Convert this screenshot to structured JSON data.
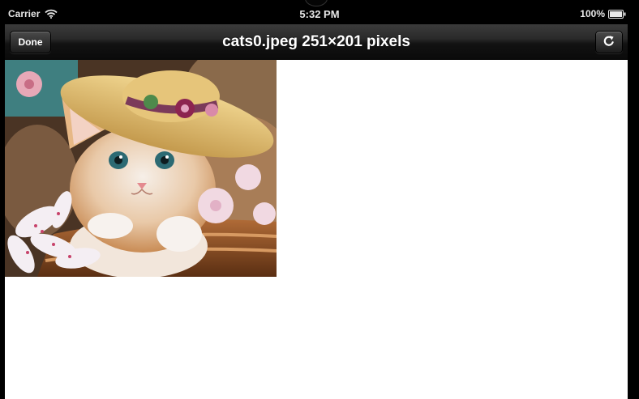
{
  "status_bar": {
    "carrier": "Carrier",
    "time": "5:32 PM",
    "battery": "100%",
    "icons": [
      "wifi-icon",
      "battery-icon"
    ]
  },
  "nav_bar": {
    "done_label": "Done",
    "title": "cats0.jpeg 251×201 pixels",
    "refresh_icon": "refresh-icon"
  },
  "image": {
    "subject": "kitten wearing a straw hat in a wicker basket with flowers"
  },
  "colors": {
    "nav_gradient_top": "#3b3b3b",
    "nav_gradient_bottom": "#0a0a0a",
    "content_background": "#ffffff"
  }
}
